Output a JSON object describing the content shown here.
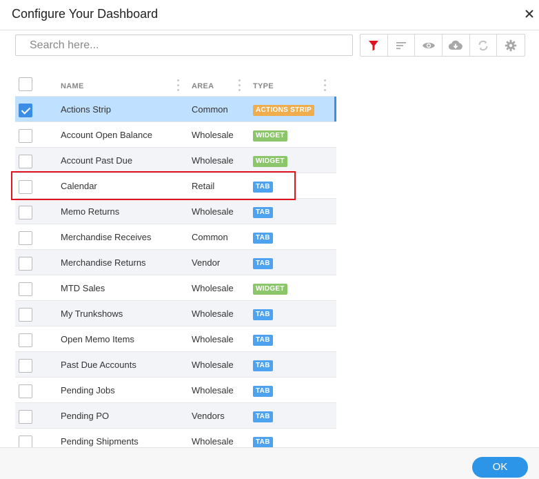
{
  "dialog": {
    "title": "Configure Your Dashboard",
    "close_icon": "close-icon"
  },
  "search": {
    "placeholder": "Search here...",
    "value": ""
  },
  "toolbar": {
    "icons": [
      "filter-icon",
      "sort-icon",
      "eye-icon",
      "cloud-download-icon",
      "refresh-icon",
      "gear-icon"
    ],
    "active_color": "#e0141e"
  },
  "grid": {
    "columns": {
      "name": "NAME",
      "area": "AREA",
      "type": "TYPE"
    },
    "rows": [
      {
        "name": "Actions Strip",
        "area": "Common",
        "type": "ACTIONS STRIP",
        "type_kind": "actions",
        "checked": true
      },
      {
        "name": "Account Open Balance",
        "area": "Wholesale",
        "type": "WIDGET",
        "type_kind": "widget",
        "checked": false
      },
      {
        "name": "Account Past Due",
        "area": "Wholesale",
        "type": "WIDGET",
        "type_kind": "widget",
        "checked": false
      },
      {
        "name": "Calendar",
        "area": "Retail",
        "type": "TAB",
        "type_kind": "tab",
        "checked": false
      },
      {
        "name": "Memo Returns",
        "area": "Wholesale",
        "type": "TAB",
        "type_kind": "tab",
        "checked": false
      },
      {
        "name": "Merchandise Receives",
        "area": "Common",
        "type": "TAB",
        "type_kind": "tab",
        "checked": false
      },
      {
        "name": "Merchandise Returns",
        "area": "Vendor",
        "type": "TAB",
        "type_kind": "tab",
        "checked": false
      },
      {
        "name": "MTD Sales",
        "area": "Wholesale",
        "type": "WIDGET",
        "type_kind": "widget",
        "checked": false
      },
      {
        "name": "My Trunkshows",
        "area": "Wholesale",
        "type": "TAB",
        "type_kind": "tab",
        "checked": false
      },
      {
        "name": "Open Memo Items",
        "area": "Wholesale",
        "type": "TAB",
        "type_kind": "tab",
        "checked": false
      },
      {
        "name": "Past Due Accounts",
        "area": "Wholesale",
        "type": "TAB",
        "type_kind": "tab",
        "checked": false
      },
      {
        "name": "Pending Jobs",
        "area": "Wholesale",
        "type": "TAB",
        "type_kind": "tab",
        "checked": false
      },
      {
        "name": "Pending PO",
        "area": "Vendors",
        "type": "TAB",
        "type_kind": "tab",
        "checked": false
      },
      {
        "name": "Pending Shipments",
        "area": "Wholesale",
        "type": "TAB",
        "type_kind": "tab",
        "checked": false
      }
    ]
  },
  "footer": {
    "ok_label": "OK"
  },
  "colors": {
    "selected_row": "#bfe0ff",
    "accent": "#3a8ee6",
    "actions_badge": "#f0ad4e",
    "widget_badge": "#8cc66a",
    "tab_badge": "#4da3f0",
    "highlight_box": "#e0141e"
  }
}
